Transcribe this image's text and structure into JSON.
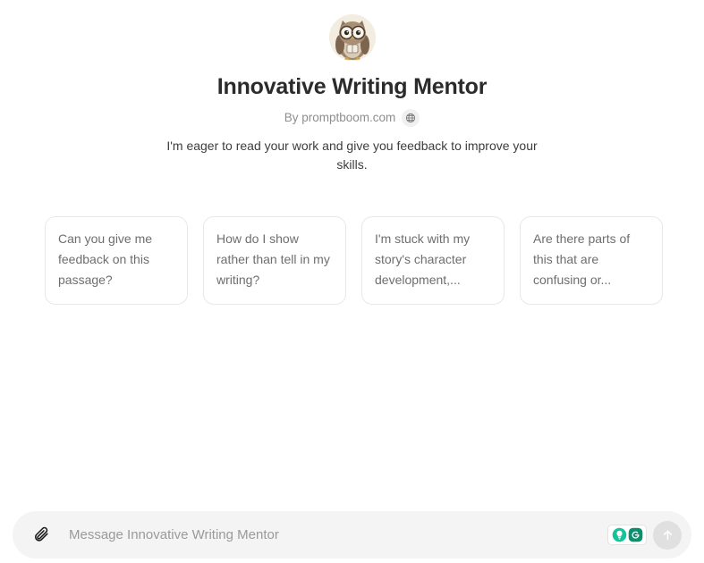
{
  "gpt": {
    "title": "Innovative Writing Mentor",
    "byline": "By promptboom.com",
    "website_icon": "globe-icon",
    "avatar_icon": "owl-avatar",
    "description": "I'm eager to read your work and give you feedback to improve your skills."
  },
  "starters": [
    {
      "text": "Can you give me feedback on this passage?"
    },
    {
      "text": "How do I show rather than tell in my writing?"
    },
    {
      "text": "I'm stuck with my story's character development,..."
    },
    {
      "text": "Are there parts of this that are confusing or..."
    }
  ],
  "composer": {
    "attach_icon": "paperclip-icon",
    "placeholder": "Message Innovative Writing Mentor",
    "value": "",
    "grammarly_icon": "grammarly-logo",
    "grammarly_assist_icon": "lightbulb-icon",
    "send_icon": "arrow-up-icon"
  },
  "colors": {
    "page_background": "#ffffff",
    "composer_background": "#f4f4f4",
    "card_border": "#e8e8e8",
    "muted_text": "#8e8e8e",
    "grammarly_green": "#15c39a",
    "grammarly_dark_green": "#0d8f6f",
    "send_button": "#e0e0e0"
  }
}
